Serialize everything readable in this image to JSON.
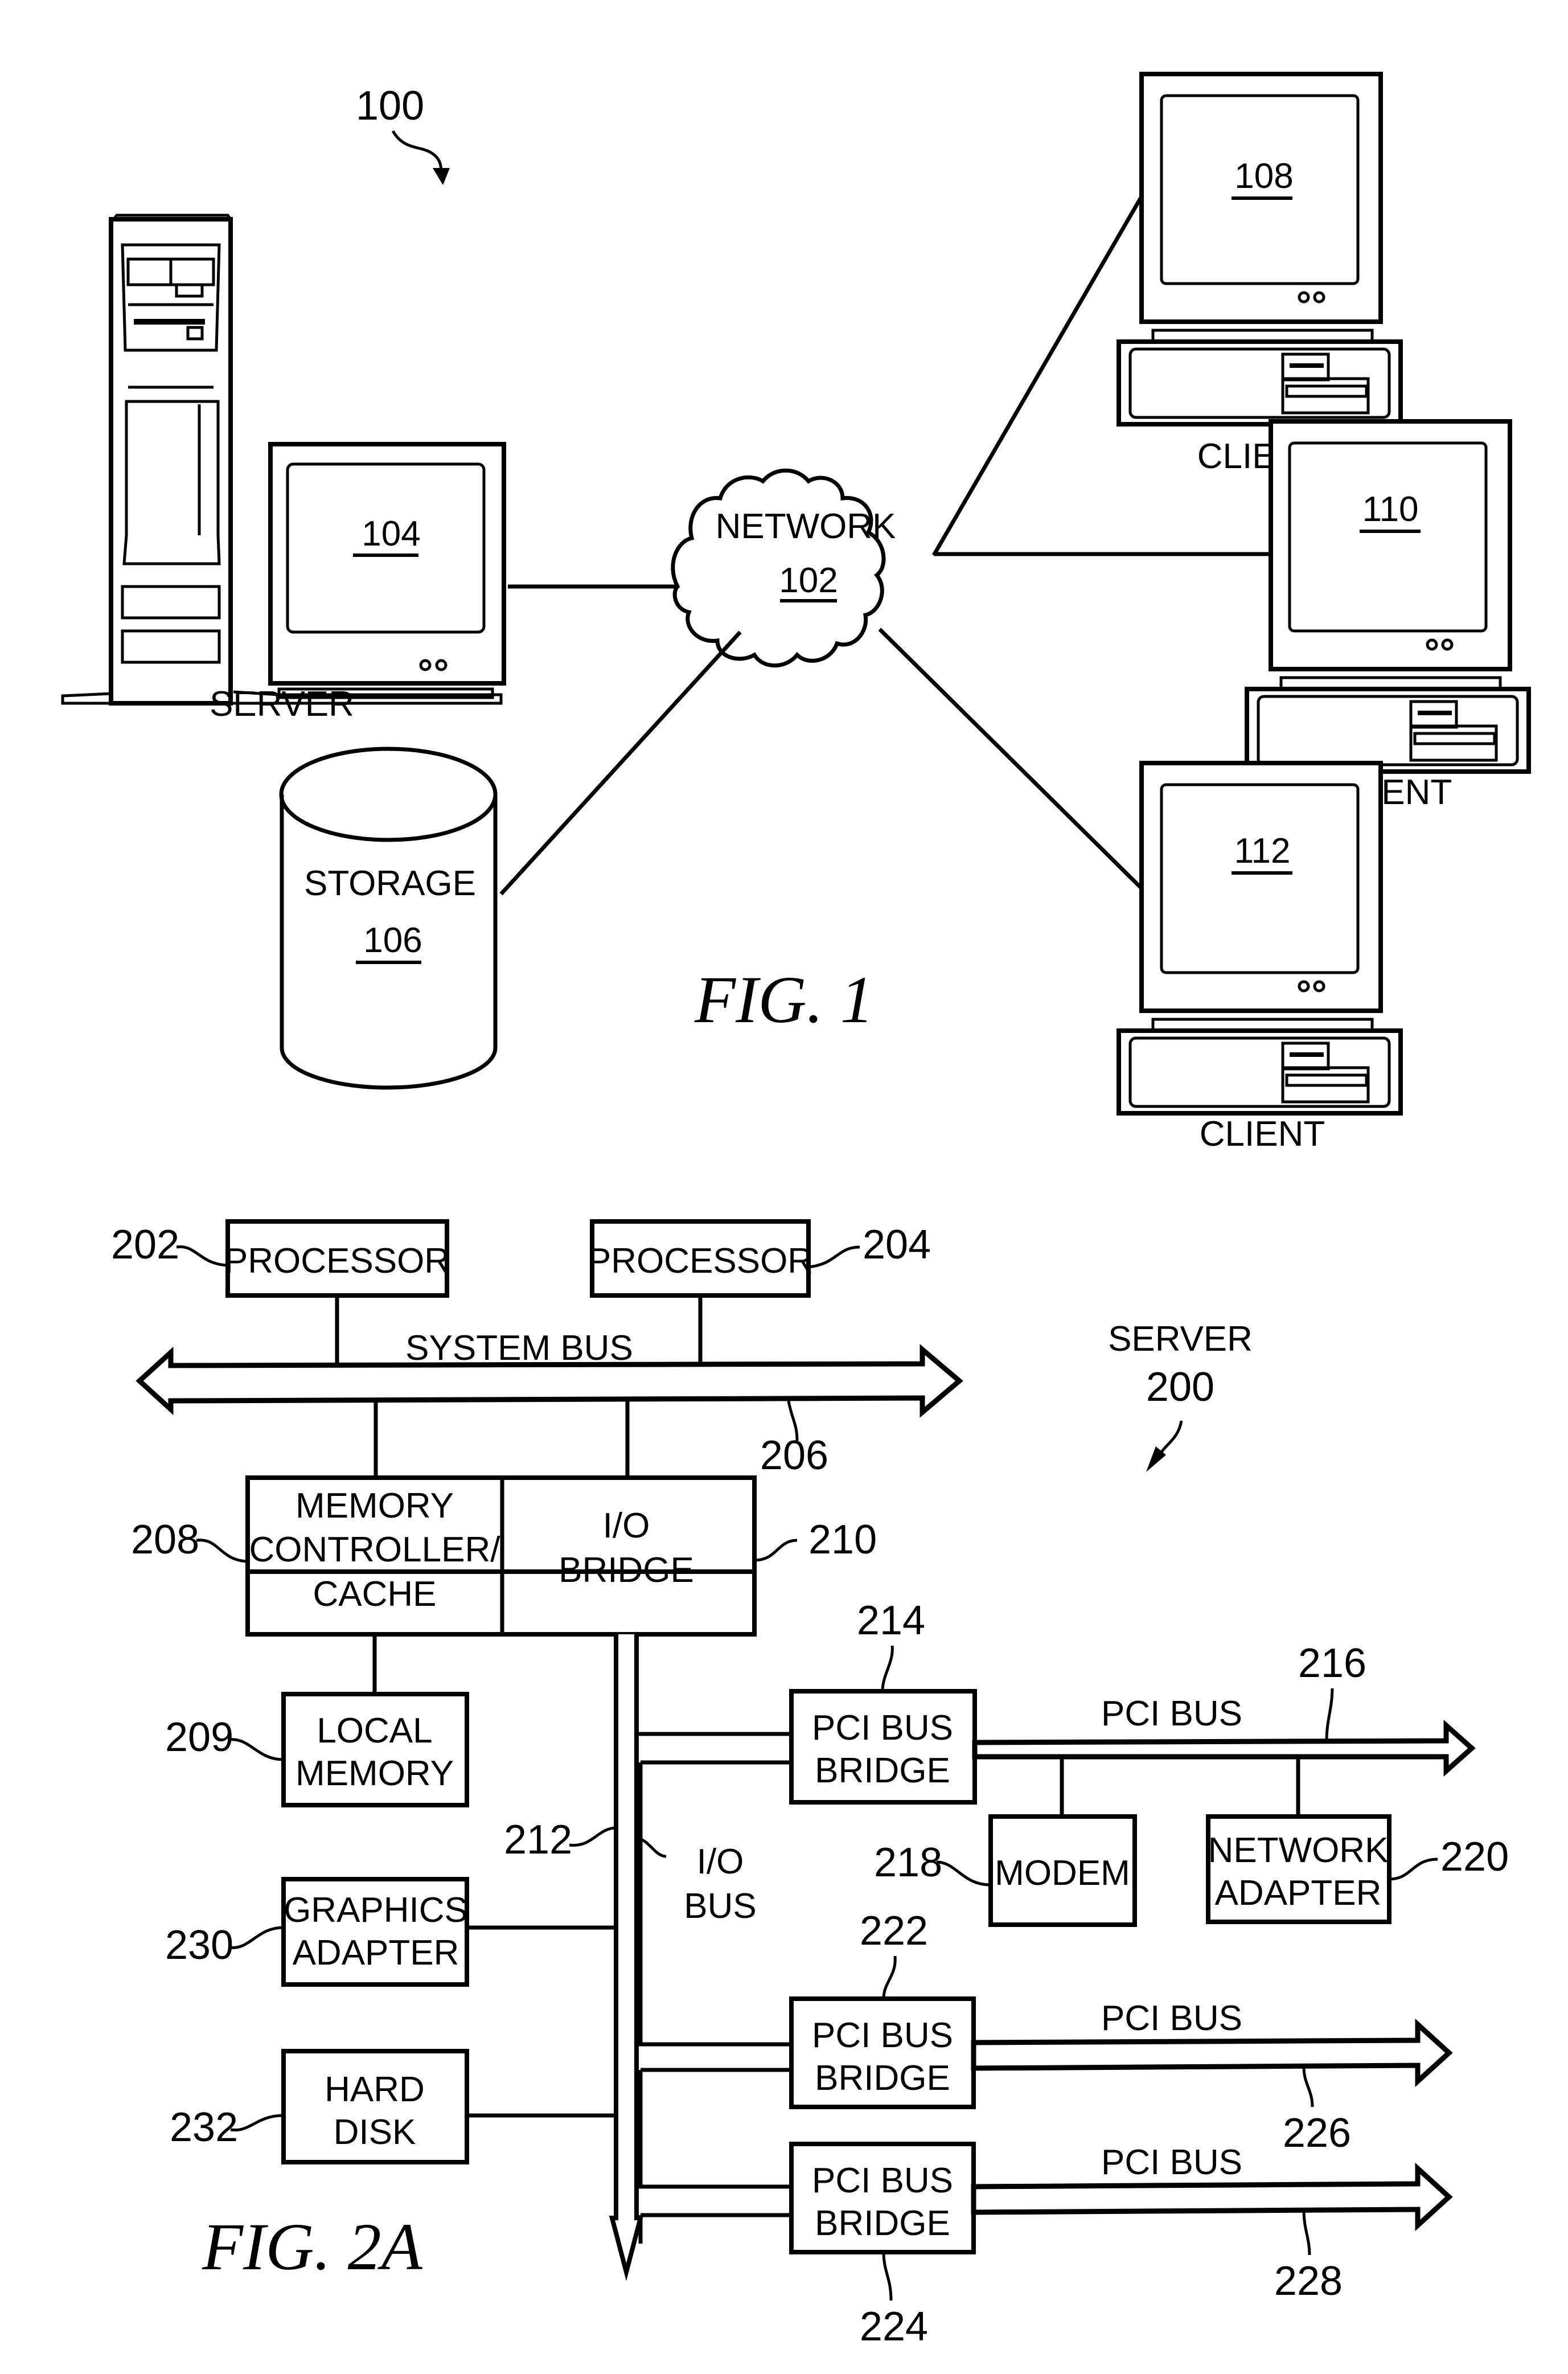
{
  "fig1": {
    "ref": "100",
    "caption": "FIG.  1",
    "server": {
      "label": "SERVER",
      "ref": "104"
    },
    "network": {
      "label": "NETWORK",
      "ref": "102"
    },
    "storage": {
      "label": "STORAGE",
      "ref": "106"
    },
    "clients": [
      {
        "label": "CLIENT",
        "ref": "108"
      },
      {
        "label": "CLIENT",
        "ref": "110"
      },
      {
        "label": "CLIENT",
        "ref": "112"
      }
    ]
  },
  "fig2a": {
    "caption": "FIG.  2A",
    "title": "SERVER",
    "ref": "200",
    "processor1": {
      "label": "PROCESSOR",
      "ref": "202"
    },
    "processor2": {
      "label": "PROCESSOR",
      "ref": "204"
    },
    "system_bus": {
      "label": "SYSTEM BUS",
      "ref": "206"
    },
    "mem_ctrl": {
      "lines": [
        "MEMORY",
        "CONTROLLER/",
        "CACHE"
      ],
      "ref": "208"
    },
    "io_bridge": {
      "lines": [
        "I/O",
        "BRIDGE"
      ],
      "ref": "210"
    },
    "local_memory": {
      "lines": [
        "LOCAL",
        "MEMORY"
      ],
      "ref": "209"
    },
    "io_bus": {
      "lines": [
        "I/O",
        "BUS"
      ],
      "ref": "212"
    },
    "graphics": {
      "lines": [
        "GRAPHICS",
        "ADAPTER"
      ],
      "ref": "230"
    },
    "hard_disk": {
      "lines": [
        "HARD",
        "DISK"
      ],
      "ref": "232"
    },
    "pci_bridge1": {
      "lines": [
        "PCI BUS",
        "BRIDGE"
      ],
      "ref": "214"
    },
    "pci_bus1": {
      "label": "PCI BUS",
      "ref": "216"
    },
    "modem": {
      "label": "MODEM",
      "ref": "218"
    },
    "net_adapter": {
      "lines": [
        "NETWORK",
        "ADAPTER"
      ],
      "ref": "220"
    },
    "pci_bridge2": {
      "lines": [
        "PCI BUS",
        "BRIDGE"
      ],
      "ref": "222"
    },
    "pci_bus2": {
      "label": "PCI BUS",
      "ref": "226"
    },
    "pci_bridge3": {
      "lines": [
        "PCI BUS",
        "BRIDGE"
      ],
      "ref": "224"
    },
    "pci_bus3": {
      "label": "PCI BUS",
      "ref": "228"
    }
  }
}
